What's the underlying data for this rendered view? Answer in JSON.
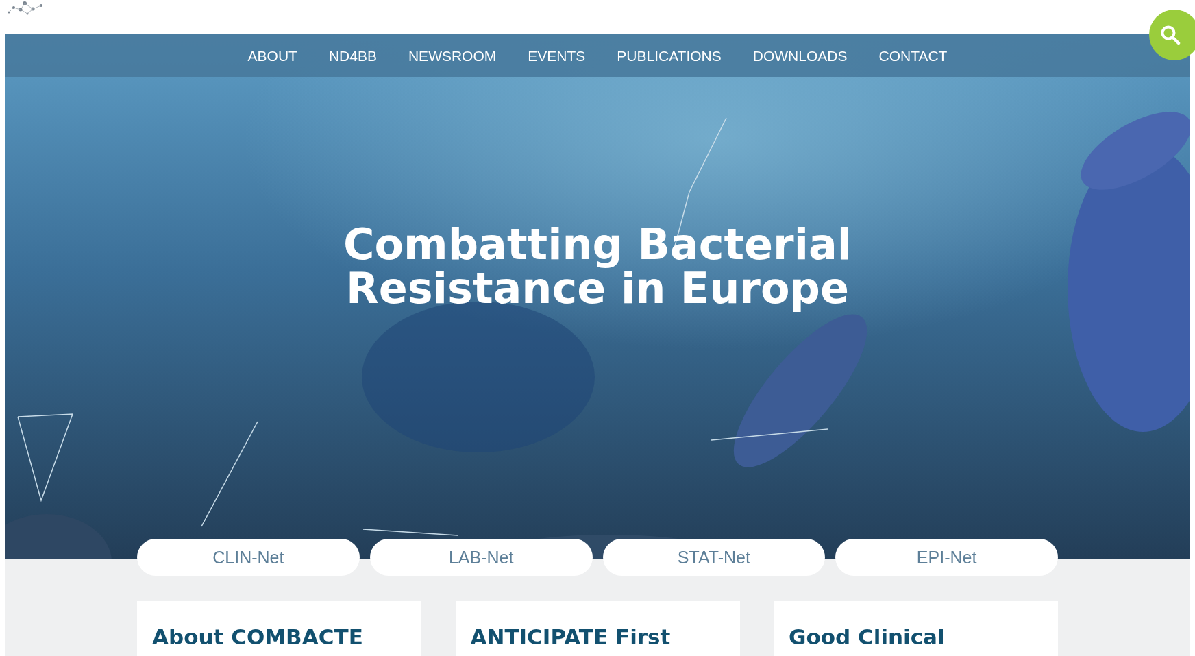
{
  "nav": {
    "items": [
      {
        "label": "ABOUT"
      },
      {
        "label": "ND4BB"
      },
      {
        "label": "NEWSROOM"
      },
      {
        "label": "EVENTS"
      },
      {
        "label": "PUBLICATIONS"
      },
      {
        "label": "DOWNLOADS"
      },
      {
        "label": "CONTACT"
      }
    ]
  },
  "hero": {
    "title": "Combatting Bacterial Resistance in Europe"
  },
  "network_tabs": [
    {
      "label": "CLIN-Net"
    },
    {
      "label": "LAB-Net"
    },
    {
      "label": "STAT-Net"
    },
    {
      "label": "EPI-Net"
    }
  ],
  "cards": [
    {
      "title": "About COMBACTE"
    },
    {
      "title": "ANTICIPATE First"
    },
    {
      "title": "Good Clinical"
    }
  ]
}
